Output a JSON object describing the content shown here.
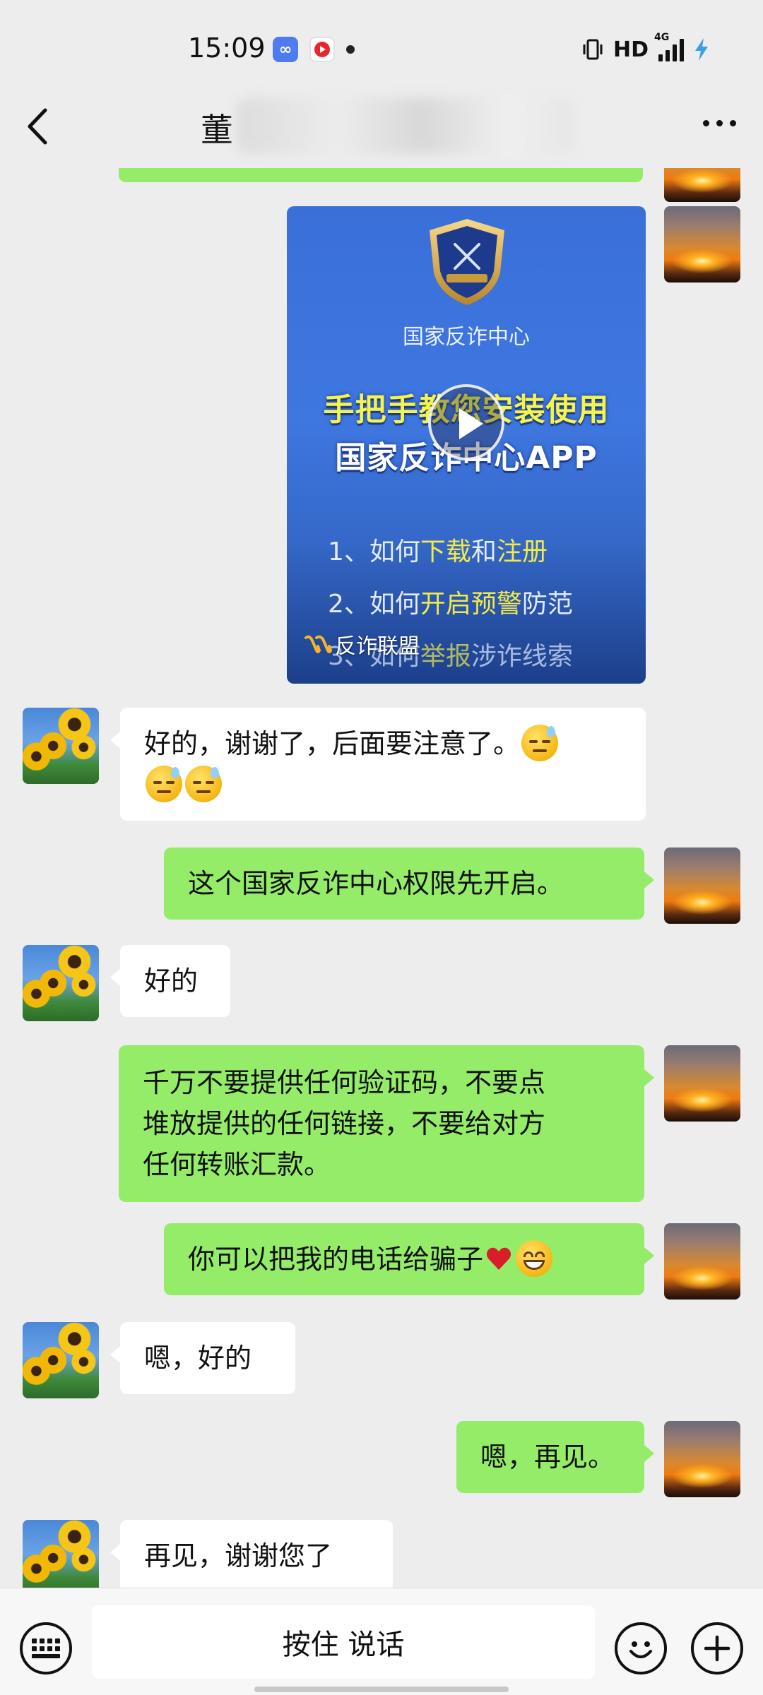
{
  "status_bar": {
    "time": "15:09",
    "network": "HD",
    "signal_label": "4G",
    "apps": [
      "infinity-app-icon",
      "video-app-icon"
    ]
  },
  "header": {
    "title": "董"
  },
  "video_card": {
    "org_name": "国家反诈中心",
    "headline_1": "手把手教您安装使用",
    "headline_2": "国家反诈中心APP",
    "list": [
      {
        "prefix": "1、如何",
        "hl1": "下载",
        "mid": "和",
        "hl2": "注册",
        "suffix": ""
      },
      {
        "prefix": "2、如何",
        "hl1": "开启预警",
        "mid": "防范",
        "hl2": "",
        "suffix": ""
      },
      {
        "prefix": "3、如何",
        "hl1": "举报",
        "mid": "涉诈线索",
        "hl2": "",
        "suffix": ""
      }
    ],
    "channel": "反诈联盟"
  },
  "messages": [
    {
      "side": "in",
      "text": "好的，谢谢了，后面要注意了。"
    },
    {
      "side": "out",
      "text": "这个国家反诈中心权限先开启。"
    },
    {
      "side": "in",
      "text": "好的"
    },
    {
      "side": "out",
      "lines": [
        "千万不要提供任何验证码，不要点",
        "堆放提供的任何链接，不要给对方",
        "任何转账汇款。"
      ]
    },
    {
      "side": "out",
      "text": "你可以把我的电话给骗子"
    },
    {
      "side": "in",
      "text": "嗯，好的"
    },
    {
      "side": "out",
      "text": "嗯，再见。"
    },
    {
      "side": "in",
      "text": "再见，谢谢您了"
    }
  ],
  "input_bar": {
    "voice_label": "按住 说话"
  },
  "colors": {
    "background": "#ededed",
    "bubble_out": "#95ec69",
    "bubble_in": "#ffffff",
    "video_blue": "#3f77e0"
  }
}
